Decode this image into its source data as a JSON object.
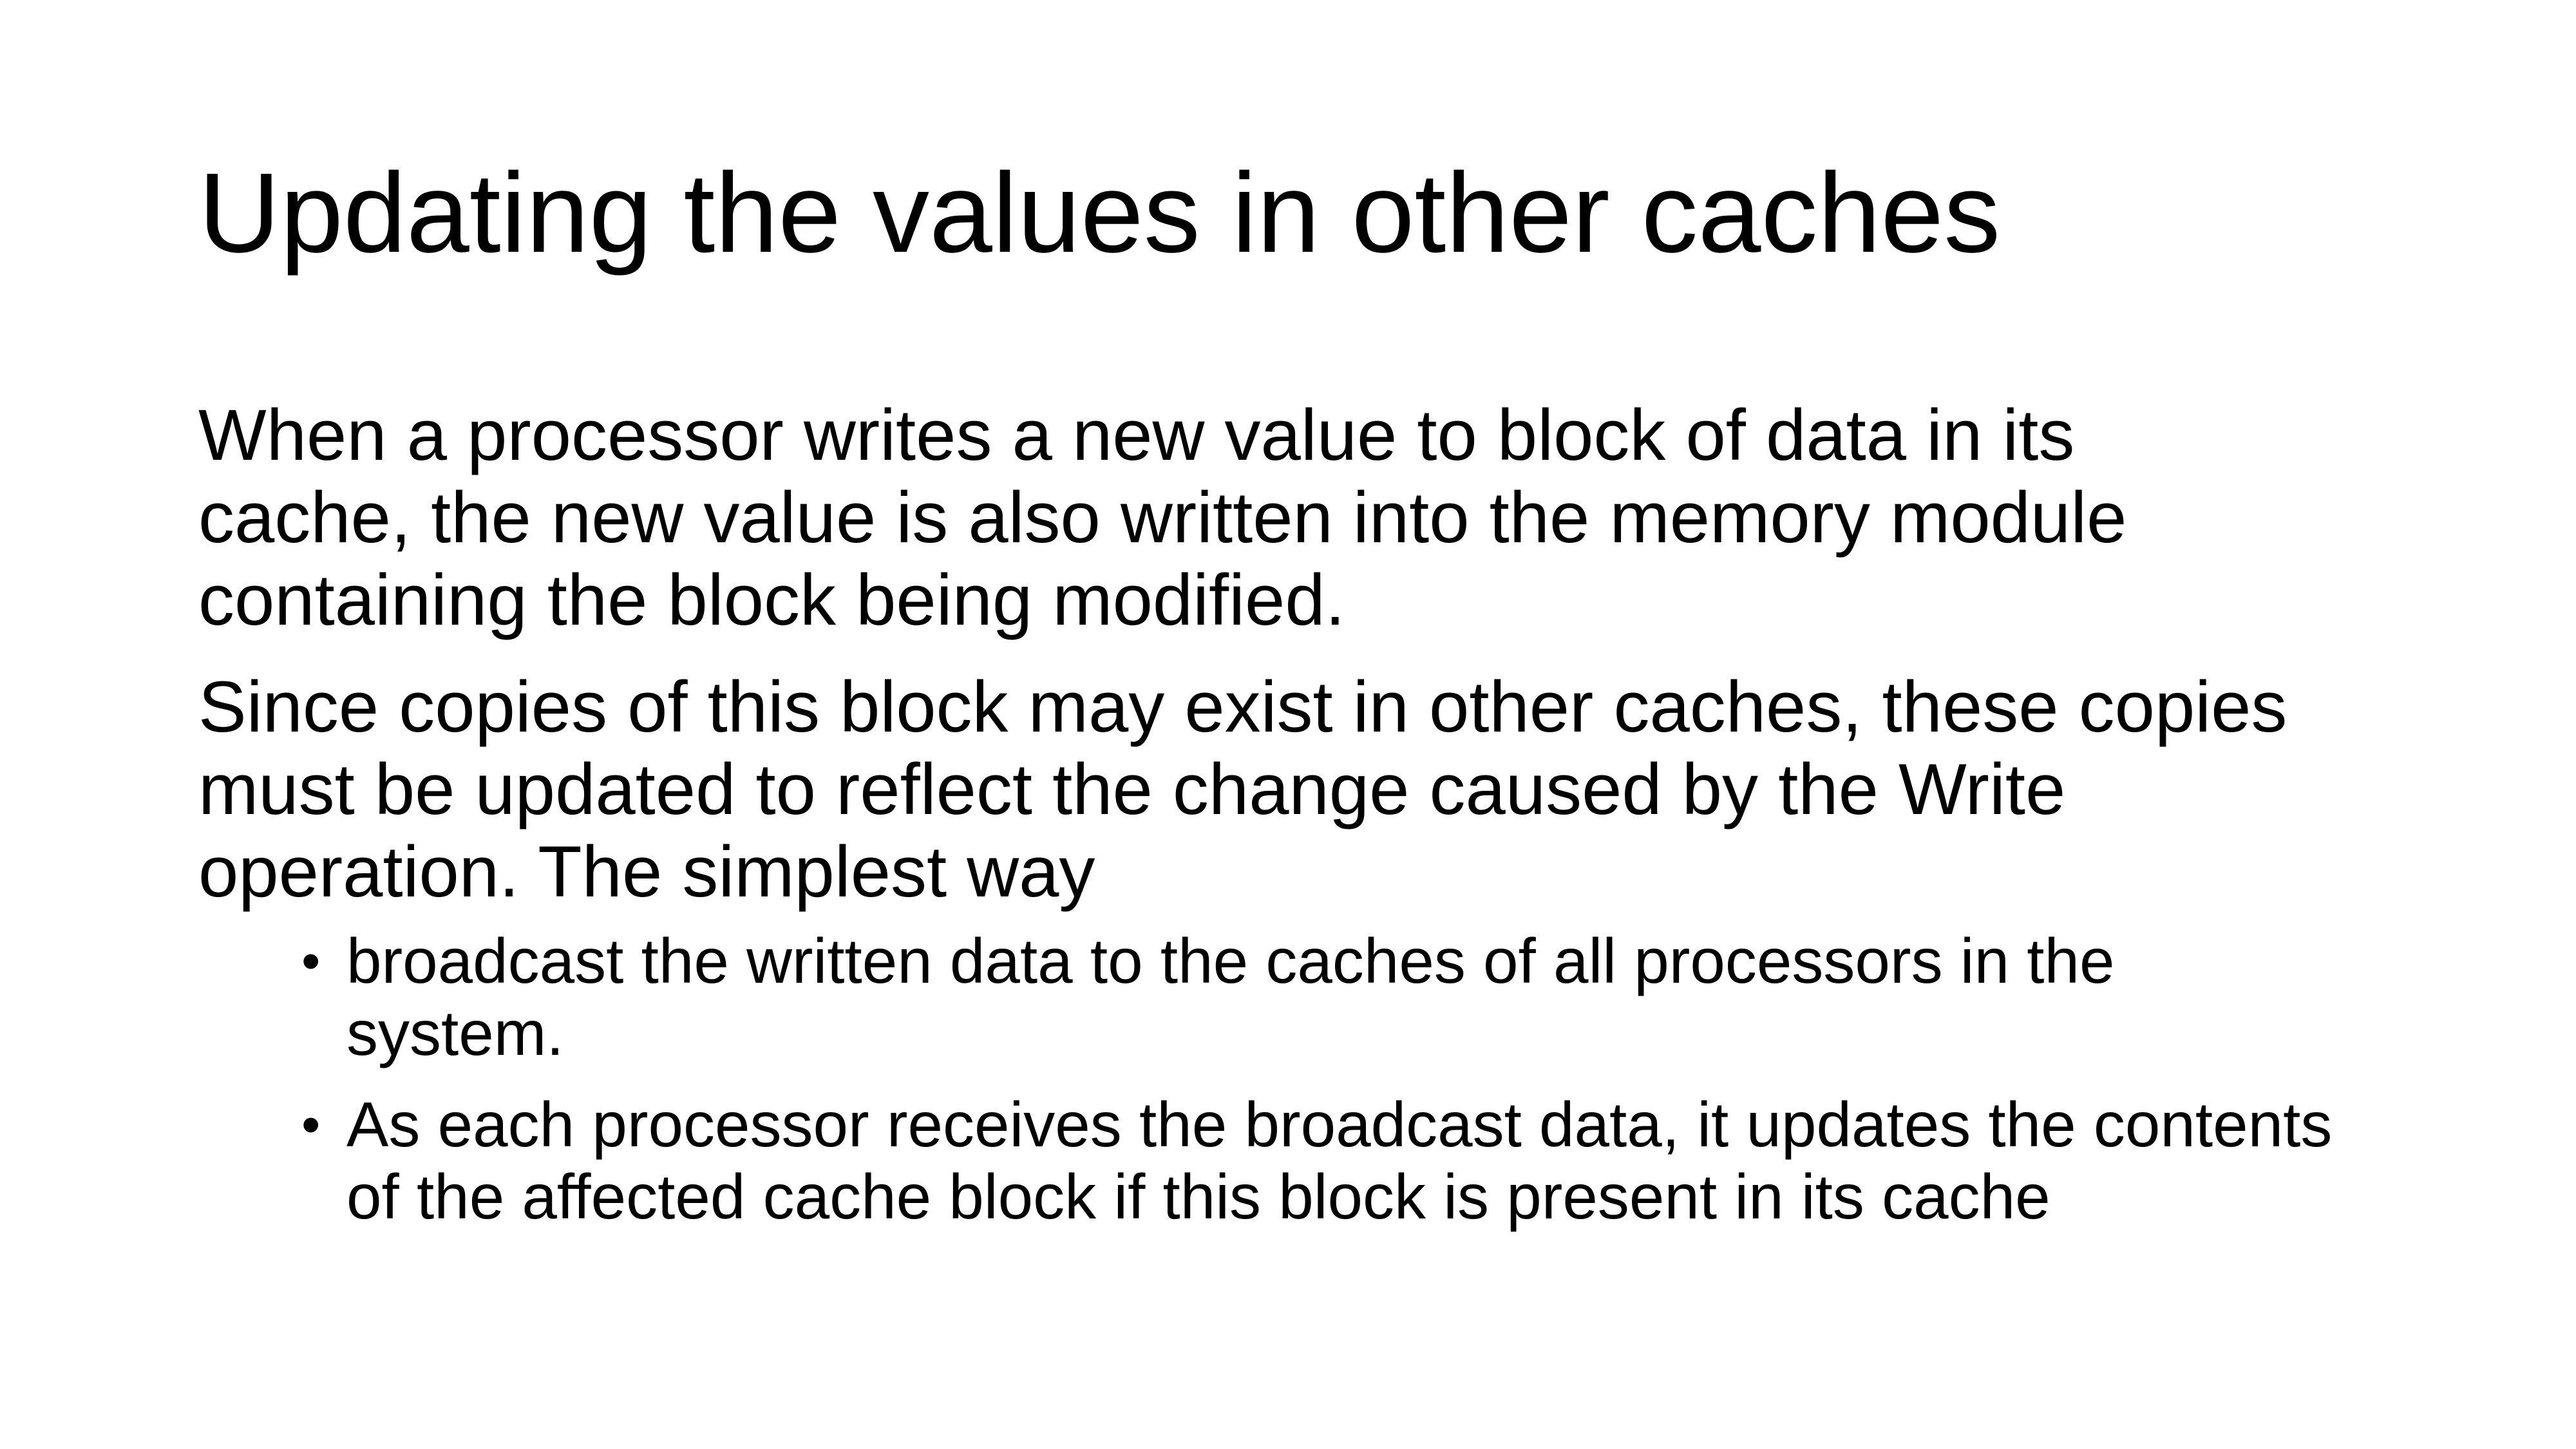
{
  "slide": {
    "title": "Updating the values in other caches",
    "paragraphs": [
      {
        "lines": [
          "When a processor writes a new value to  block of data in its",
          "cache, the new value is also written into the memory module",
          "containing the block being modified."
        ]
      },
      {
        "lines": [
          "Since copies of this block may exist in other caches, these copies",
          "must be updated to reflect the change caused by the Write",
          "operation. The simplest way"
        ]
      }
    ],
    "bullet_symbol": "•",
    "bullets": [
      {
        "lines": [
          "broadcast the written data to the caches of all processors in the",
          "system."
        ]
      },
      {
        "lines": [
          "As each processor receives the broadcast data, it updates the contents",
          "of the affected cache block if this block is present in its cache"
        ]
      }
    ]
  }
}
